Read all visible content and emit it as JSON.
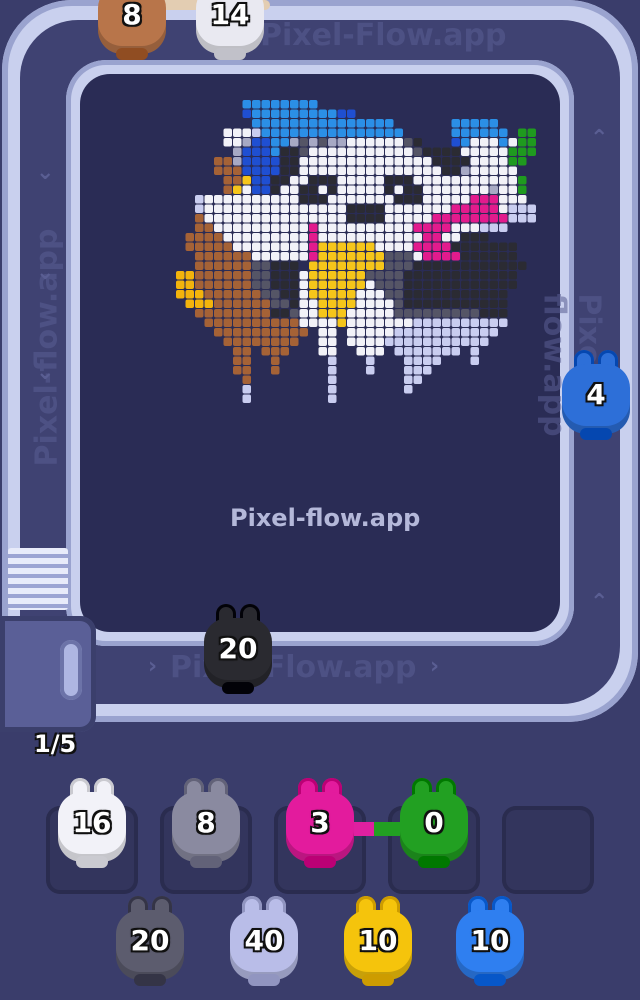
{
  "watermark_center": "Pixel-flow.app",
  "watermark_track": "Pixel-Flow.app",
  "watermark_side": "Pixel-flow.app",
  "progress": "1/5",
  "top_bunnies": [
    {
      "count": "8",
      "color": "#b8754a"
    },
    {
      "count": "14",
      "color": "#e9e9f1"
    }
  ],
  "track_bunnies": [
    {
      "count": "20",
      "color": "#2a2a30"
    },
    {
      "count": "4",
      "color": "#2d6fd8"
    }
  ],
  "slots": [
    {
      "count": "16",
      "color": "#f2f2f8"
    },
    {
      "count": "8",
      "color": "#8a8aa0"
    },
    {
      "count": "3",
      "color": "#e31b9d"
    },
    {
      "count": "0",
      "color": "#22a022"
    },
    {
      "count": "",
      "color": ""
    }
  ],
  "queue": [
    {
      "count": "20",
      "color": "#5c5c6e"
    },
    {
      "count": "40",
      "color": "#b9bde8"
    },
    {
      "count": "10",
      "color": "#f5c40c"
    },
    {
      "count": "10",
      "color": "#2f7ff0"
    }
  ],
  "pixel_palette": {
    "b": "#2b8fe6",
    "B": "#1f4fd1",
    "w": "#f2f2f8",
    "g": "#a7a9c4",
    "d": "#555566",
    "k": "#2b2b33",
    "y": "#f6c61a",
    "m": "#e21b8d",
    "n": "#a56236",
    "o": "#f3b40c",
    "G": "#1f9a1f",
    "l": "#c9cdf0",
    "s": "#8c8ea8"
  },
  "pixel_rows": [
    "...........bbbbbbbb.......................",
    "...........BbbbbbbbbbBB...................",
    "............bbbbbbbbbbbbbbb......bbbbb....",
    ".........wwwlbbbbbbbbbbbbbbb.....bbbbbb.GG",
    ".........wwgBBbbgdgdggwwwwwwdk...BbwwwbwGG",
    "..........gBBBbkkdwwwwwwwwwwwdkkkkwwwwwGGG",
    "........nngBBBBkkwwwwwwwwwwwwwwkkkkwwwwGG.",
    "........nnnBBBBkkwwwwwwwwwwwwwwwkkgwwwww..",
    ".........nnyBBkkwwkkkwwwwwkkkwwwwwwwwwwwG.",
    ".........nywBBkwwkkwkwwwwwkwkkwwwwwwwgwwG.",
    "......lwwwwwwwwwwkkkwwwwwwwkkkwwwwwmmmwww.",
    "......lwwwwwwwwwwwwwwwkkkkwwwwwwwmmmmmwlll",
    "......nwwwwwwwwwwwwwwwkkkkwwwwwmmmmmmmmlll",
    "......nnwwwwwwwwwwmwwwwwwwwwwmmmmwwwlll...",
    ".....nnnnwwwwwwwwwmwwwwwwwwwwwmmwwkkk.....",
    ".....nnnnnwwwwwwwwmyyyyyywwwwmmmmkkkkkkk..",
    "......nnnnnnwwwwwwmyyyyyyydddwmmmmkkkkkk..",
    "......nnnnnnddkkk.yyyyyyyydddkkkkkkkkkkkk.",
    "....oonnnnnnddkkkwyyyyyyddddkkkkkkkkkkkk..",
    "....oonnnnnnddkkkwyyyyyywdddkkkkkkkkkkkk..",
    "....ooonnnnnnddkkwyyyyywwwddkkkkkkkkkkk...",
    ".....ooonnnnnnddkwwyyyywwwwdkkkkkkkkkkk...",
    "......nnnnnnnnkkdwwyyywwwwwdddddddddkkk...",
    ".......nnnnnnnnnnwwwwywwwwwwwllllllllll...",
    "........nnnnnnnnnn.ww.wwwwwlllllllllll....",
    ".........nnnnnnnn..ww.wwwwlllllllllll.....",
    "..........nn.nnn...ww..www.lllllll.l......",
    "..........nn..n.....l...l...llll...l......",
    "..........nn..n.....l...l...lll...........",
    "...........n........l.......ll............",
    "...........l........l.......l.............",
    "...........l........l......................"
  ]
}
